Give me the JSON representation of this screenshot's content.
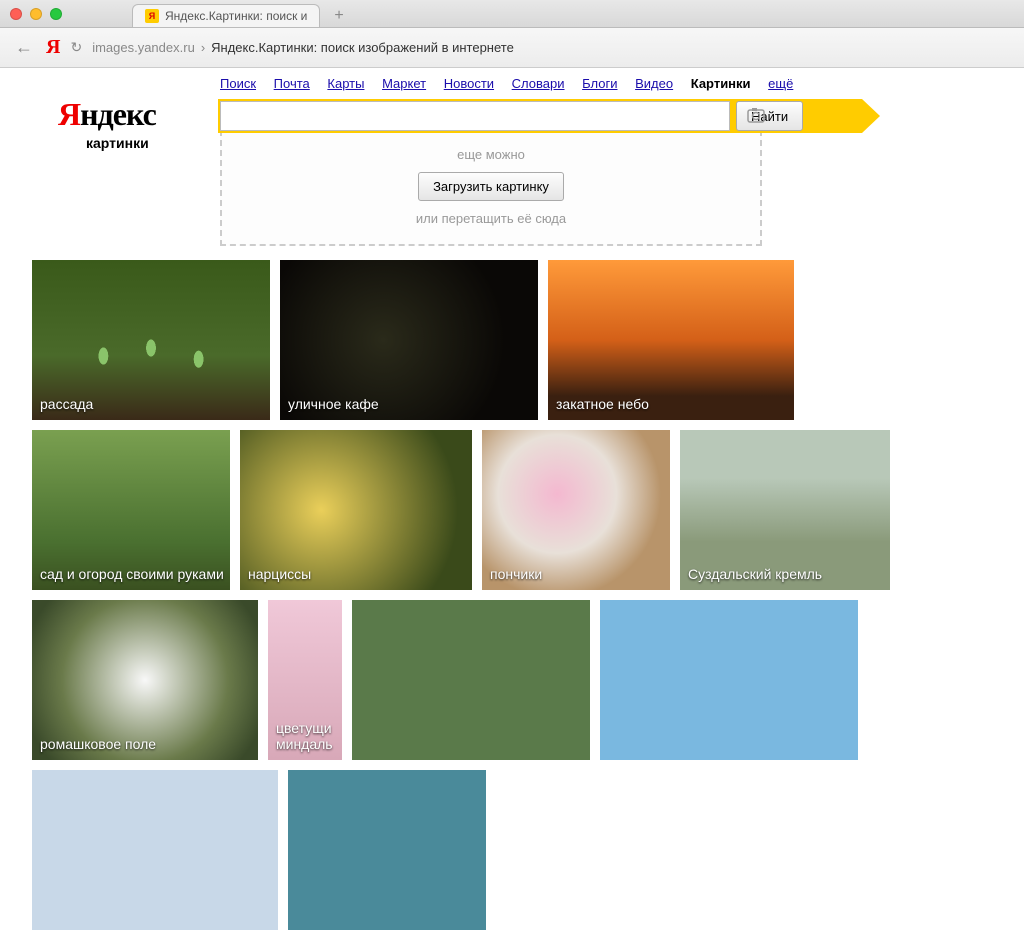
{
  "browser": {
    "tab_title": "Яндекс.Картинки: поиск и",
    "address_host": "images.yandex.ru",
    "address_sep": "›",
    "address_title": "Яндекс.Картинки: поиск изображений в интернете"
  },
  "nav": {
    "items": [
      "Поиск",
      "Почта",
      "Карты",
      "Маркет",
      "Новости",
      "Словари",
      "Блоги",
      "Видео"
    ],
    "active": "Картинки",
    "more": "ещё"
  },
  "logo": {
    "ya": "Я",
    "rest": "ндекс",
    "sub": "картинки"
  },
  "search": {
    "value": "",
    "find_label": "Найти"
  },
  "upload": {
    "hint1": "еще можно",
    "button": "Загрузить картинку",
    "hint2": "или перетащить её сюда"
  },
  "tiles_row1": [
    {
      "label": "рассада"
    },
    {
      "label": "уличное кафе"
    },
    {
      "label": "закатное небо"
    },
    {
      "label": "сад и огород своими руками"
    }
  ],
  "tiles_row2": [
    {
      "label": "нарциссы"
    },
    {
      "label": "пончики"
    },
    {
      "label": "Суздальский кремль"
    },
    {
      "label": "ромашковое поле"
    },
    {
      "label": "цветущи миндаль"
    }
  ]
}
